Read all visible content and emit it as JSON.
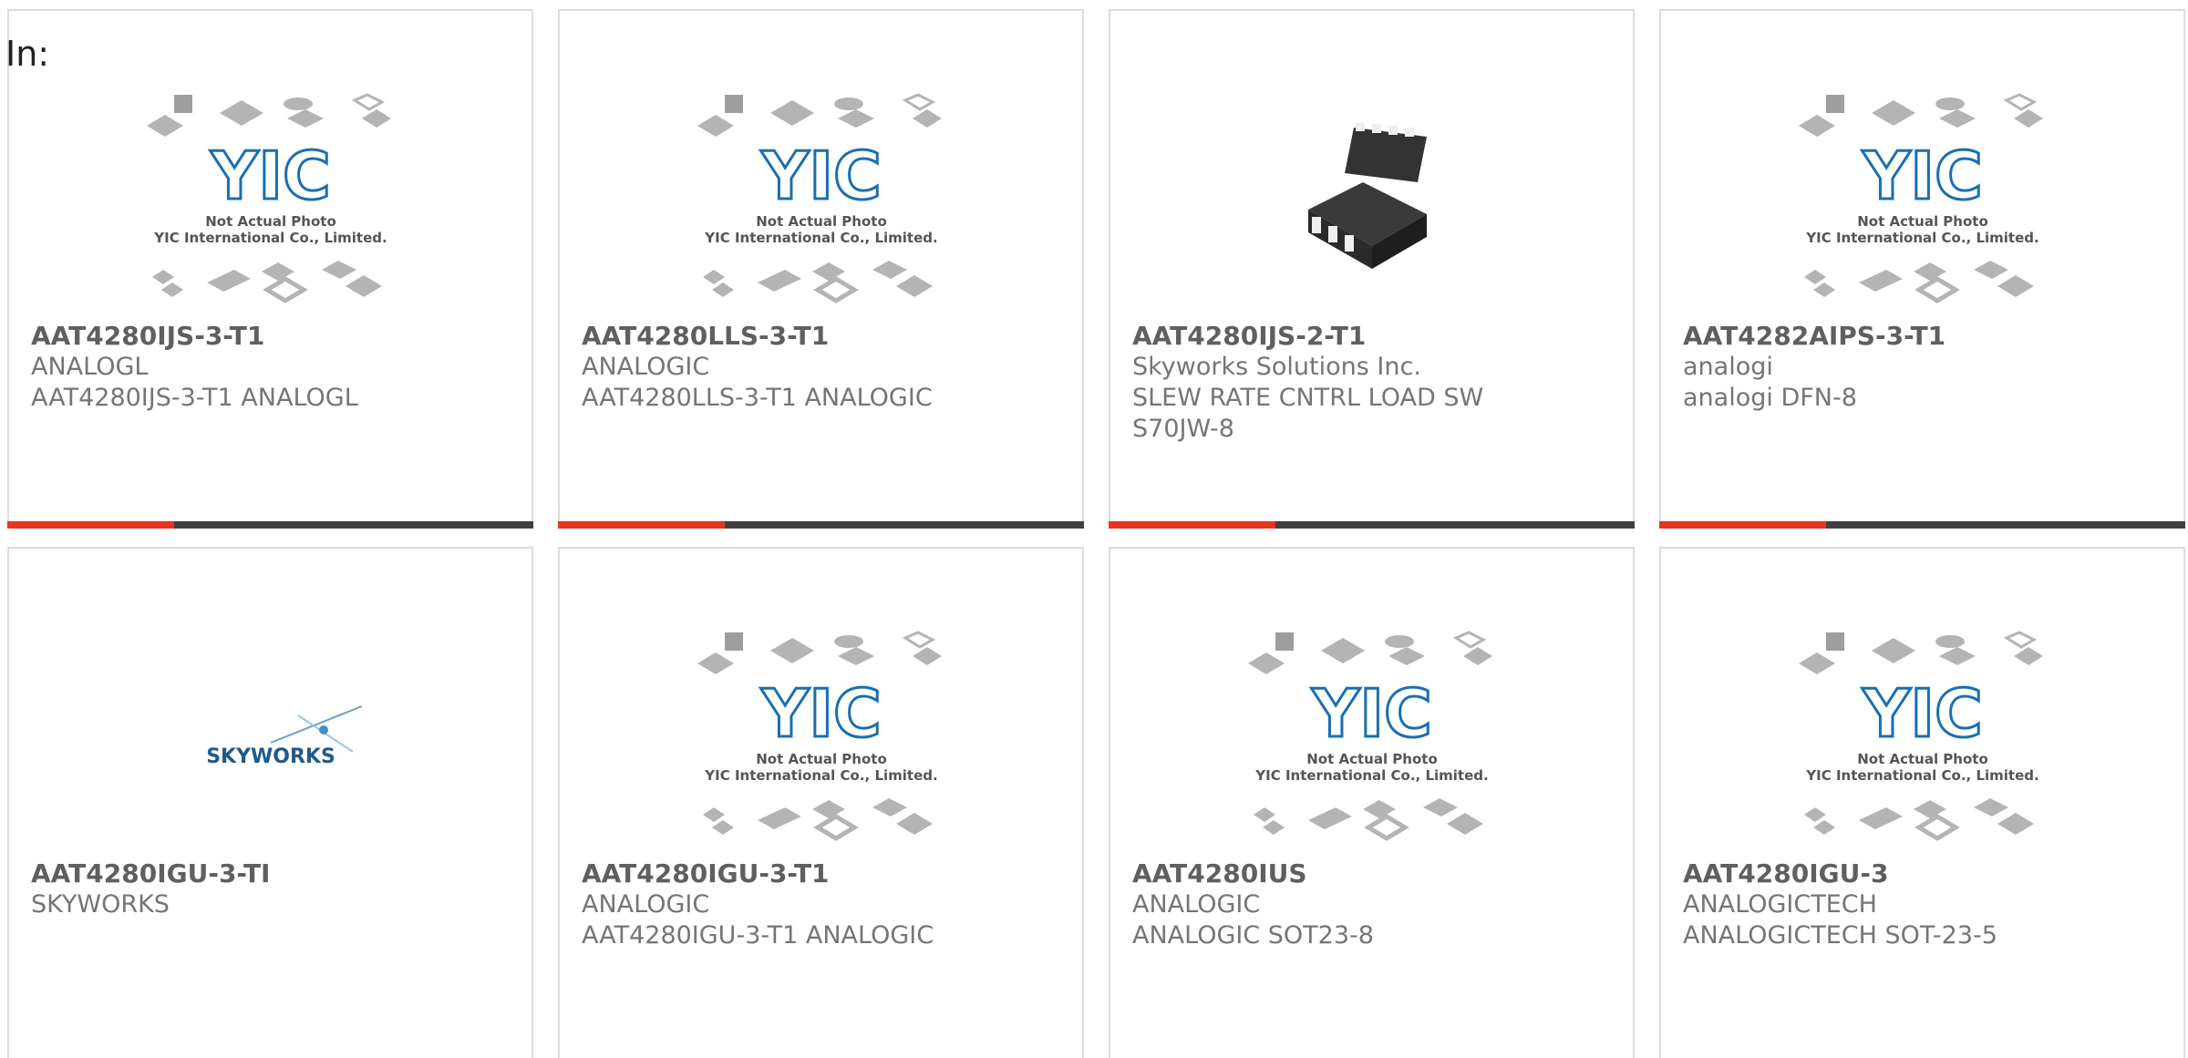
{
  "in_label": "In:",
  "placeholder_image": {
    "line1": "Not Actual Photo",
    "line2": "YIC International Co., Limited.",
    "logo": "YIC",
    "brand_color": "#1a6fb0"
  },
  "skyworks_logo_text": "SKYWORKS",
  "accent_colors": {
    "bar_red": "#e8351d",
    "bar_dark": "#404040"
  },
  "products": [
    {
      "part": "AAT4280IJS-3-T1",
      "maker": "ANALOGL",
      "desc": "AAT4280IJS-3-T1 ANALOGL",
      "desc2": "",
      "image": "yic-placeholder"
    },
    {
      "part": "AAT4280LLS-3-T1",
      "maker": "ANALOGIC",
      "desc": "AAT4280LLS-3-T1 ANALOGIC",
      "desc2": "",
      "image": "yic-placeholder"
    },
    {
      "part": "AAT4280IJS-2-T1",
      "maker": "Skyworks Solutions Inc.",
      "desc": "SLEW RATE CNTRL LOAD SW",
      "desc2": "S70JW-8",
      "image": "chip-photo"
    },
    {
      "part": "AAT4282AIPS-3-T1",
      "maker": "analogi",
      "desc": "analogi DFN-8",
      "desc2": "",
      "image": "yic-placeholder"
    },
    {
      "part": "AAT4280IGU-3-TI",
      "maker": "SKYWORKS",
      "desc": "",
      "desc2": "",
      "image": "skyworks-logo"
    },
    {
      "part": "AAT4280IGU-3-T1",
      "maker": "ANALOGIC",
      "desc": "AAT4280IGU-3-T1 ANALOGIC",
      "desc2": "",
      "image": "yic-placeholder"
    },
    {
      "part": "AAT4280IUS",
      "maker": "ANALOGIC",
      "desc": "ANALOGIC SOT23-8",
      "desc2": "",
      "image": "yic-placeholder"
    },
    {
      "part": "AAT4280IGU-3",
      "maker": "ANALOGICTECH",
      "desc": "ANALOGICTECH SOT-23-5",
      "desc2": "",
      "image": "yic-placeholder"
    }
  ]
}
